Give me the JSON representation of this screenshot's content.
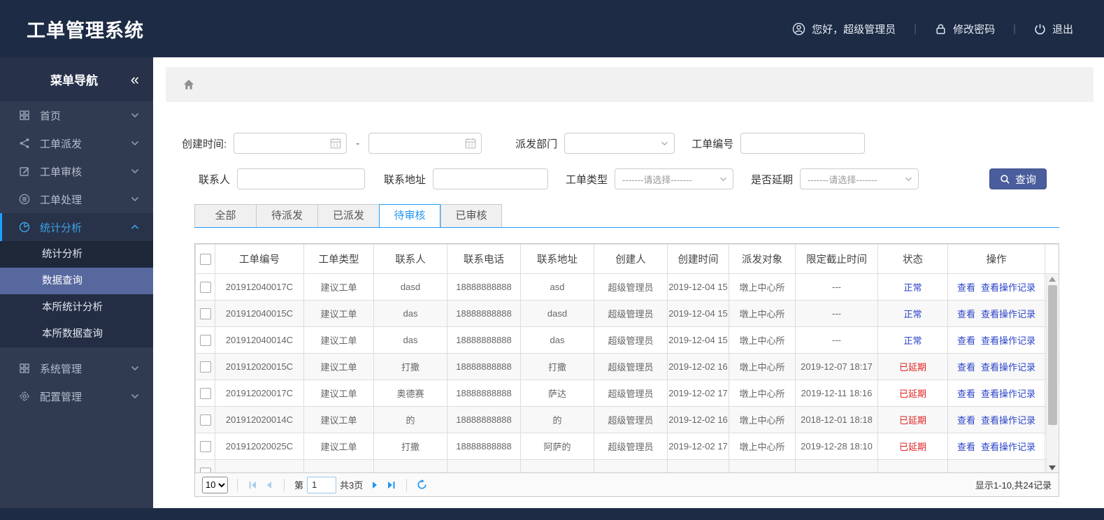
{
  "app": {
    "title": "工单管理系统"
  },
  "header": {
    "greeting": "您好，超级管理员",
    "change_password": "修改密码",
    "logout": "退出"
  },
  "sidebar": {
    "title": "菜单导航",
    "collapse_icon": "«",
    "items": [
      {
        "label": "首页",
        "icon": "grid-icon"
      },
      {
        "label": "工单派发",
        "icon": "share-icon"
      },
      {
        "label": "工单审核",
        "icon": "edit-icon"
      },
      {
        "label": "工单处理",
        "icon": "list-circle-icon"
      },
      {
        "label": "统计分析",
        "icon": "pie-chart-icon",
        "active": true,
        "children": [
          "统计分析",
          "数据查询",
          "本所统计分析",
          "本所数据查询"
        ],
        "selected_child": "数据查询"
      },
      {
        "label": "系统管理",
        "icon": "grid-icon"
      },
      {
        "label": "配置管理",
        "icon": "gear-icon"
      }
    ]
  },
  "filters": {
    "create_time_label": "创建时间:",
    "date_separator": "-",
    "dispatch_dept_label": "派发部门",
    "order_no_label": "工单编号",
    "contact_label": "联系人",
    "address_label": "联系地址",
    "order_type_label": "工单类型",
    "order_type_placeholder": "-------请选择-------",
    "delay_label": "是否延期",
    "delay_placeholder": "-------请选择-------",
    "search_button": "查询"
  },
  "tabs": [
    {
      "label": "全部"
    },
    {
      "label": "待派发"
    },
    {
      "label": "已派发"
    },
    {
      "label": "待审核",
      "active": true
    },
    {
      "label": "已审核"
    }
  ],
  "table": {
    "columns": [
      "工单编号",
      "工单类型",
      "联系人",
      "联系电话",
      "联系地址",
      "创建人",
      "创建时间",
      "派发对象",
      "限定截止时间",
      "状态",
      "操作"
    ],
    "action_labels": [
      "查看",
      "查看操作记录"
    ],
    "rows": [
      {
        "order_no": "201912040017C",
        "type": "建议工单",
        "contact": "dasd",
        "phone": "18888888888",
        "address": "asd",
        "creator": "超级管理员",
        "create_time": "2019-12-04 15",
        "target": "墩上中心所",
        "deadline": "---",
        "status": "正常",
        "status_type": "normal"
      },
      {
        "order_no": "201912040015C",
        "type": "建议工单",
        "contact": "das",
        "phone": "18888888888",
        "address": "dasd",
        "creator": "超级管理员",
        "create_time": "2019-12-04 15",
        "target": "墩上中心所",
        "deadline": "---",
        "status": "正常",
        "status_type": "normal"
      },
      {
        "order_no": "201912040014C",
        "type": "建议工单",
        "contact": "das",
        "phone": "18888888888",
        "address": "das",
        "creator": "超级管理员",
        "create_time": "2019-12-04 15",
        "target": "墩上中心所",
        "deadline": "---",
        "status": "正常",
        "status_type": "normal"
      },
      {
        "order_no": "201912020015C",
        "type": "建议工单",
        "contact": "打撒",
        "phone": "18888888888",
        "address": "打撒",
        "creator": "超级管理员",
        "create_time": "2019-12-02 16",
        "target": "墩上中心所",
        "deadline": "2019-12-07 18:17",
        "status": "已延期",
        "status_type": "delayed"
      },
      {
        "order_no": "201912020017C",
        "type": "建议工单",
        "contact": "奥德赛",
        "phone": "18888888888",
        "address": "萨达",
        "creator": "超级管理员",
        "create_time": "2019-12-02 17",
        "target": "墩上中心所",
        "deadline": "2019-12-11 18:16",
        "status": "已延期",
        "status_type": "delayed"
      },
      {
        "order_no": "201912020014C",
        "type": "建议工单",
        "contact": "的",
        "phone": "18888888888",
        "address": "的",
        "creator": "超级管理员",
        "create_time": "2019-12-02 16",
        "target": "墩上中心所",
        "deadline": "2018-12-01 18:18",
        "status": "已延期",
        "status_type": "delayed"
      },
      {
        "order_no": "201912020025C",
        "type": "建议工单",
        "contact": "打撒",
        "phone": "18888888888",
        "address": "阿萨的",
        "creator": "超级管理员",
        "create_time": "2019-12-02 17",
        "target": "墩上中心所",
        "deadline": "2019-12-28 18:10",
        "status": "已延期",
        "status_type": "delayed"
      }
    ]
  },
  "pagination": {
    "page_size": "10",
    "page_label_prefix": "第",
    "current_page": "1",
    "total_pages_label": "共3页",
    "records_label": "显示1-10,共24记录"
  },
  "colors": {
    "header_navy": "#1d2b45",
    "sidebar": "#303b52",
    "accent_blue": "#1e9fff",
    "selected_menu": "#57689f",
    "link_blue": "#2b43c8",
    "status_normal": "#2b43c8",
    "status_delayed": "#e02121",
    "button_indigo": "#4a5d9c"
  }
}
